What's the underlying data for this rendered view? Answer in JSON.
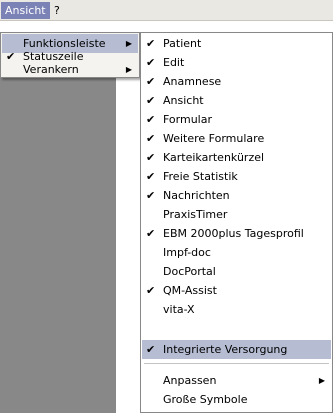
{
  "menubar": {
    "items": [
      {
        "label": "Ansicht"
      },
      {
        "label": "?"
      }
    ]
  },
  "submenu_view": {
    "items": [
      {
        "label": "Funktionsleiste",
        "checked": false,
        "submenu": true,
        "highlighted": true
      },
      {
        "label": "Statuszeile",
        "checked": true,
        "submenu": false
      },
      {
        "label": "Verankern",
        "checked": false,
        "submenu": true
      }
    ]
  },
  "submenu_toolbar": {
    "items": [
      {
        "label": "Patient",
        "checked": true
      },
      {
        "label": "Edit",
        "checked": true
      },
      {
        "label": "Anamnese",
        "checked": true
      },
      {
        "label": "Ansicht",
        "checked": true
      },
      {
        "label": "Formular",
        "checked": true
      },
      {
        "label": "Weitere Formulare",
        "checked": true
      },
      {
        "label": "Karteikartenkürzel",
        "checked": true
      },
      {
        "label": "Freie Statistik",
        "checked": true
      },
      {
        "label": "Nachrichten",
        "checked": true
      },
      {
        "label": "PraxisTimer",
        "checked": false
      },
      {
        "label": "EBM 2000plus Tagesprofil",
        "checked": true
      },
      {
        "label": "Impf-doc",
        "checked": false
      },
      {
        "label": "DocPortal",
        "checked": false
      },
      {
        "label": "QM-Assist",
        "checked": true
      },
      {
        "label": "vita-X",
        "checked": false
      },
      {
        "label": "Integrierte Versorgung",
        "checked": true,
        "highlighted": true
      }
    ],
    "footer_items": [
      {
        "label": "Anpassen",
        "submenu": true
      },
      {
        "label": "Große Symbole",
        "submenu": false
      }
    ]
  },
  "glyphs": {
    "check": "✔",
    "submenu_arrow": "▶"
  },
  "colors": {
    "menubar_bg": "#eae8e3",
    "active_menubar_item": "#7b82b5",
    "highlight": "#b6bdd3",
    "background_panel": "#888888"
  }
}
